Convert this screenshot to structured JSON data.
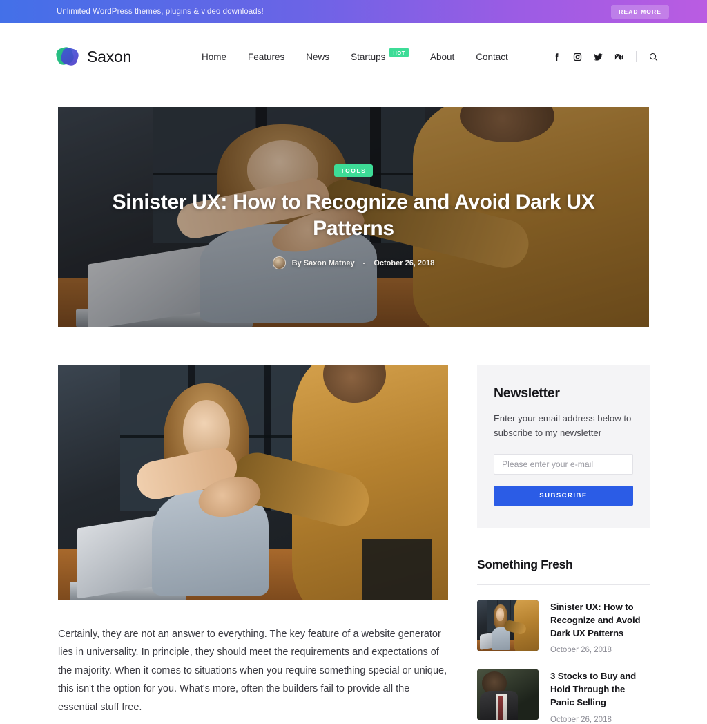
{
  "promo": {
    "text": "Unlimited WordPress themes, plugins & video downloads!",
    "button_label": "READ MORE",
    "gradient_start": "#4370e8",
    "gradient_end": "#ba5ce2"
  },
  "header": {
    "brand_name": "Saxon",
    "nav": [
      {
        "label": "Home",
        "badge": ""
      },
      {
        "label": "Features",
        "badge": ""
      },
      {
        "label": "News",
        "badge": ""
      },
      {
        "label": "Startups",
        "badge": "HOT"
      },
      {
        "label": "About",
        "badge": ""
      },
      {
        "label": "Contact",
        "badge": ""
      }
    ],
    "social": [
      "facebook-icon",
      "instagram-icon",
      "twitter-icon",
      "medium-icon"
    ],
    "search_icon": "search-icon"
  },
  "hero": {
    "category": "TOOLS",
    "category_color": "#3ddc97",
    "title": "Sinister UX: How to Recognize and Avoid Dark UX Patterns",
    "author": "By Saxon Matney",
    "separator": "-",
    "date": "October 26, 2018"
  },
  "article": {
    "body": "Certainly, they are not an answer to everything. The key feature of a website generator lies in universality. In principle, they should meet the requirements and expectations of the majority. When it comes to situations when you require something special or unique, this isn't the option for you. What's more, often the builders fail to provide all the essential stuff free."
  },
  "sidebar": {
    "newsletter": {
      "title": "Newsletter",
      "description": "Enter your email address below to subscribe to my newsletter",
      "input_value": "",
      "input_placeholder": "Please enter your e-mail",
      "submit_label": "SUBSCRIBE",
      "submit_color": "#2b5ce6"
    },
    "fresh": {
      "title": "Something Fresh",
      "items": [
        {
          "title": "Sinister UX: How to Recognize and Avoid Dark UX Patterns",
          "date": "October 26, 2018"
        },
        {
          "title": "3 Stocks to Buy and Hold Through the Panic Selling",
          "date": "October 26, 2018"
        }
      ]
    }
  }
}
